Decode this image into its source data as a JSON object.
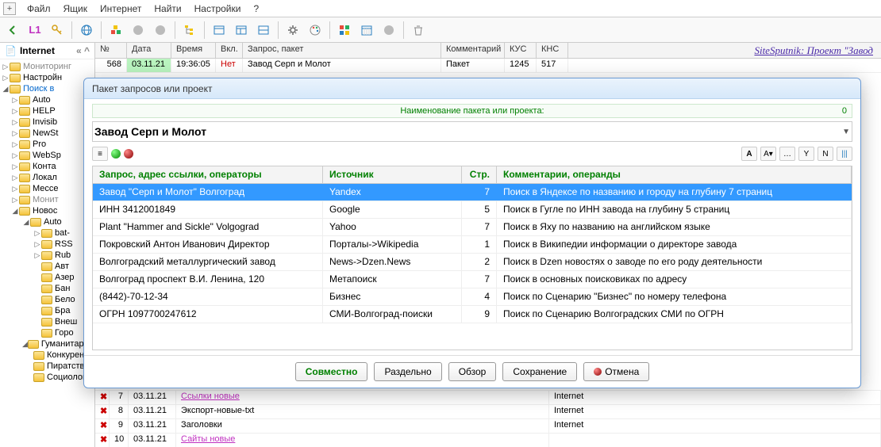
{
  "menu": [
    "Файл",
    "Ящик",
    "Интернет",
    "Найти",
    "Настройки",
    "?"
  ],
  "sidebar": {
    "title": "Internet",
    "items": [
      {
        "label": "Мониторинг",
        "level": 0,
        "chev": "▷",
        "cls": "monitor"
      },
      {
        "label": "Настройн",
        "level": 0,
        "chev": "▷"
      },
      {
        "label": "Поиск в",
        "level": 0,
        "chev": "◢",
        "cls": "active"
      },
      {
        "label": "Auto",
        "level": 1,
        "chev": "▷"
      },
      {
        "label": "HELP",
        "level": 1,
        "chev": "▷"
      },
      {
        "label": "Invisib",
        "level": 1,
        "chev": "▷"
      },
      {
        "label": "NewSt",
        "level": 1,
        "chev": "▷"
      },
      {
        "label": "Pro",
        "level": 1,
        "chev": "▷"
      },
      {
        "label": "WebSp",
        "level": 1,
        "chev": "▷"
      },
      {
        "label": "Конта",
        "level": 1,
        "chev": "▷"
      },
      {
        "label": "Локал",
        "level": 1,
        "chev": "▷"
      },
      {
        "label": "Мессе",
        "level": 1,
        "chev": "▷"
      },
      {
        "label": "Монит",
        "level": 1,
        "chev": "▷",
        "cls": "monitor"
      },
      {
        "label": "Новос",
        "level": 1,
        "chev": "◢"
      },
      {
        "label": "Auto",
        "level": 2,
        "chev": "◢"
      },
      {
        "label": "bat-",
        "level": 3,
        "chev": "▷"
      },
      {
        "label": "RSS",
        "level": 3,
        "chev": "▷"
      },
      {
        "label": "Rub",
        "level": 3,
        "chev": "▷"
      },
      {
        "label": "Авт",
        "level": 3,
        "chev": ""
      },
      {
        "label": "Азер",
        "level": 3,
        "chev": ""
      },
      {
        "label": "Бан",
        "level": 3,
        "chev": ""
      },
      {
        "label": "Бело",
        "level": 3,
        "chev": ""
      },
      {
        "label": "Бра",
        "level": 3,
        "chev": ""
      },
      {
        "label": "Внеш",
        "level": 3,
        "chev": ""
      },
      {
        "label": "Горо",
        "level": 3,
        "chev": ""
      },
      {
        "label": "Гуманитарное",
        "level": 2,
        "chev": "◢"
      },
      {
        "label": "Конкурентная разведка",
        "level": 3,
        "chev": ""
      },
      {
        "label": "Пиратство в сфере ПО",
        "level": 3,
        "chev": ""
      },
      {
        "label": "Социология",
        "level": 3,
        "chev": ""
      }
    ]
  },
  "topgrid": {
    "headers": [
      "№",
      "Дата",
      "Время",
      "Вкл.",
      "Запрос, пакет",
      "Комментарий",
      "КУС",
      "КНС"
    ],
    "row": {
      "n": "568",
      "date": "03.11.21",
      "time": "19:36:05",
      "on": "Нет",
      "query": "Завод Серп и Молот",
      "comment": "Пакет",
      "kus": "1245",
      "kns": "517"
    }
  },
  "banner": "SiteSputnik: Проект \"Завод",
  "dialog": {
    "title": "Пакет запросов или проект",
    "label": "Наименование пакета или проекта:",
    "count": "0",
    "name": "Завод Серп и Молот",
    "headers": {
      "q": "Запрос, адрес ссылки, операторы",
      "src": "Источник",
      "pg": "Стр.",
      "cm": "Комментарии, операнды"
    },
    "rows": [
      {
        "q": "Завод \"Серп и Молот\" Волгоград",
        "src": "Yandex",
        "pg": "7",
        "cm": "Поиск в Яндексе по названию и городу на глубину 7 страниц",
        "sel": true
      },
      {
        "q": "ИНН 3412001849",
        "src": "Google",
        "pg": "5",
        "cm": "Поиск в Гугле по ИНН завода на глубину 5 страниц"
      },
      {
        "q": "Plant \"Hammer and Sickle\" Volgograd",
        "src": "Yahoo",
        "pg": "7",
        "cm": "Поиск в Яху по названию на английском языке"
      },
      {
        "q": "Покровский Антон Иванович Директор",
        "src": "Порталы->Wikipedia",
        "pg": "1",
        "cm": "Поиск в Википедии информации о директоре завода"
      },
      {
        "q": "Волгоградский металлургический завод",
        "src": "News->Dzen.News",
        "pg": "2",
        "cm": "Поиск в  Dzen новостях о заводе по его роду деятельности"
      },
      {
        "q": "Волгоград проспект В.И. Ленина, 120",
        "src": "Метапоиск",
        "pg": "7",
        "cm": "Поиск в основных поисковиках по адресу"
      },
      {
        "q": "(8442)-70-12-34",
        "src": "Бизнес",
        "pg": "4",
        "cm": "Поиск по Сценарию \"Бизнес\" по номеру телефона"
      },
      {
        "q": "ОГРН 1097700247612",
        "src": "СМИ-Волгоград-поиски",
        "pg": "9",
        "cm": "Поиск по Сценарию Волгоградских СМИ по ОГРН"
      }
    ],
    "buttons": {
      "joint": "Совместно",
      "sep": "Раздельно",
      "browse": "Обзор",
      "save": "Сохранение",
      "cancel": "Отмена"
    }
  },
  "bottomgrid": [
    {
      "n": "7",
      "date": "03.11.21",
      "name": "Ссылки новые",
      "src": "Internet",
      "link": true
    },
    {
      "n": "8",
      "date": "03.11.21",
      "name": "Экспорт-новые-txt",
      "src": "Internet"
    },
    {
      "n": "9",
      "date": "03.11.21",
      "name": "Заголовки",
      "src": "Internet"
    },
    {
      "n": "10",
      "date": "03.11.21",
      "name": "Сайты новые",
      "src": "",
      "link": true
    }
  ]
}
